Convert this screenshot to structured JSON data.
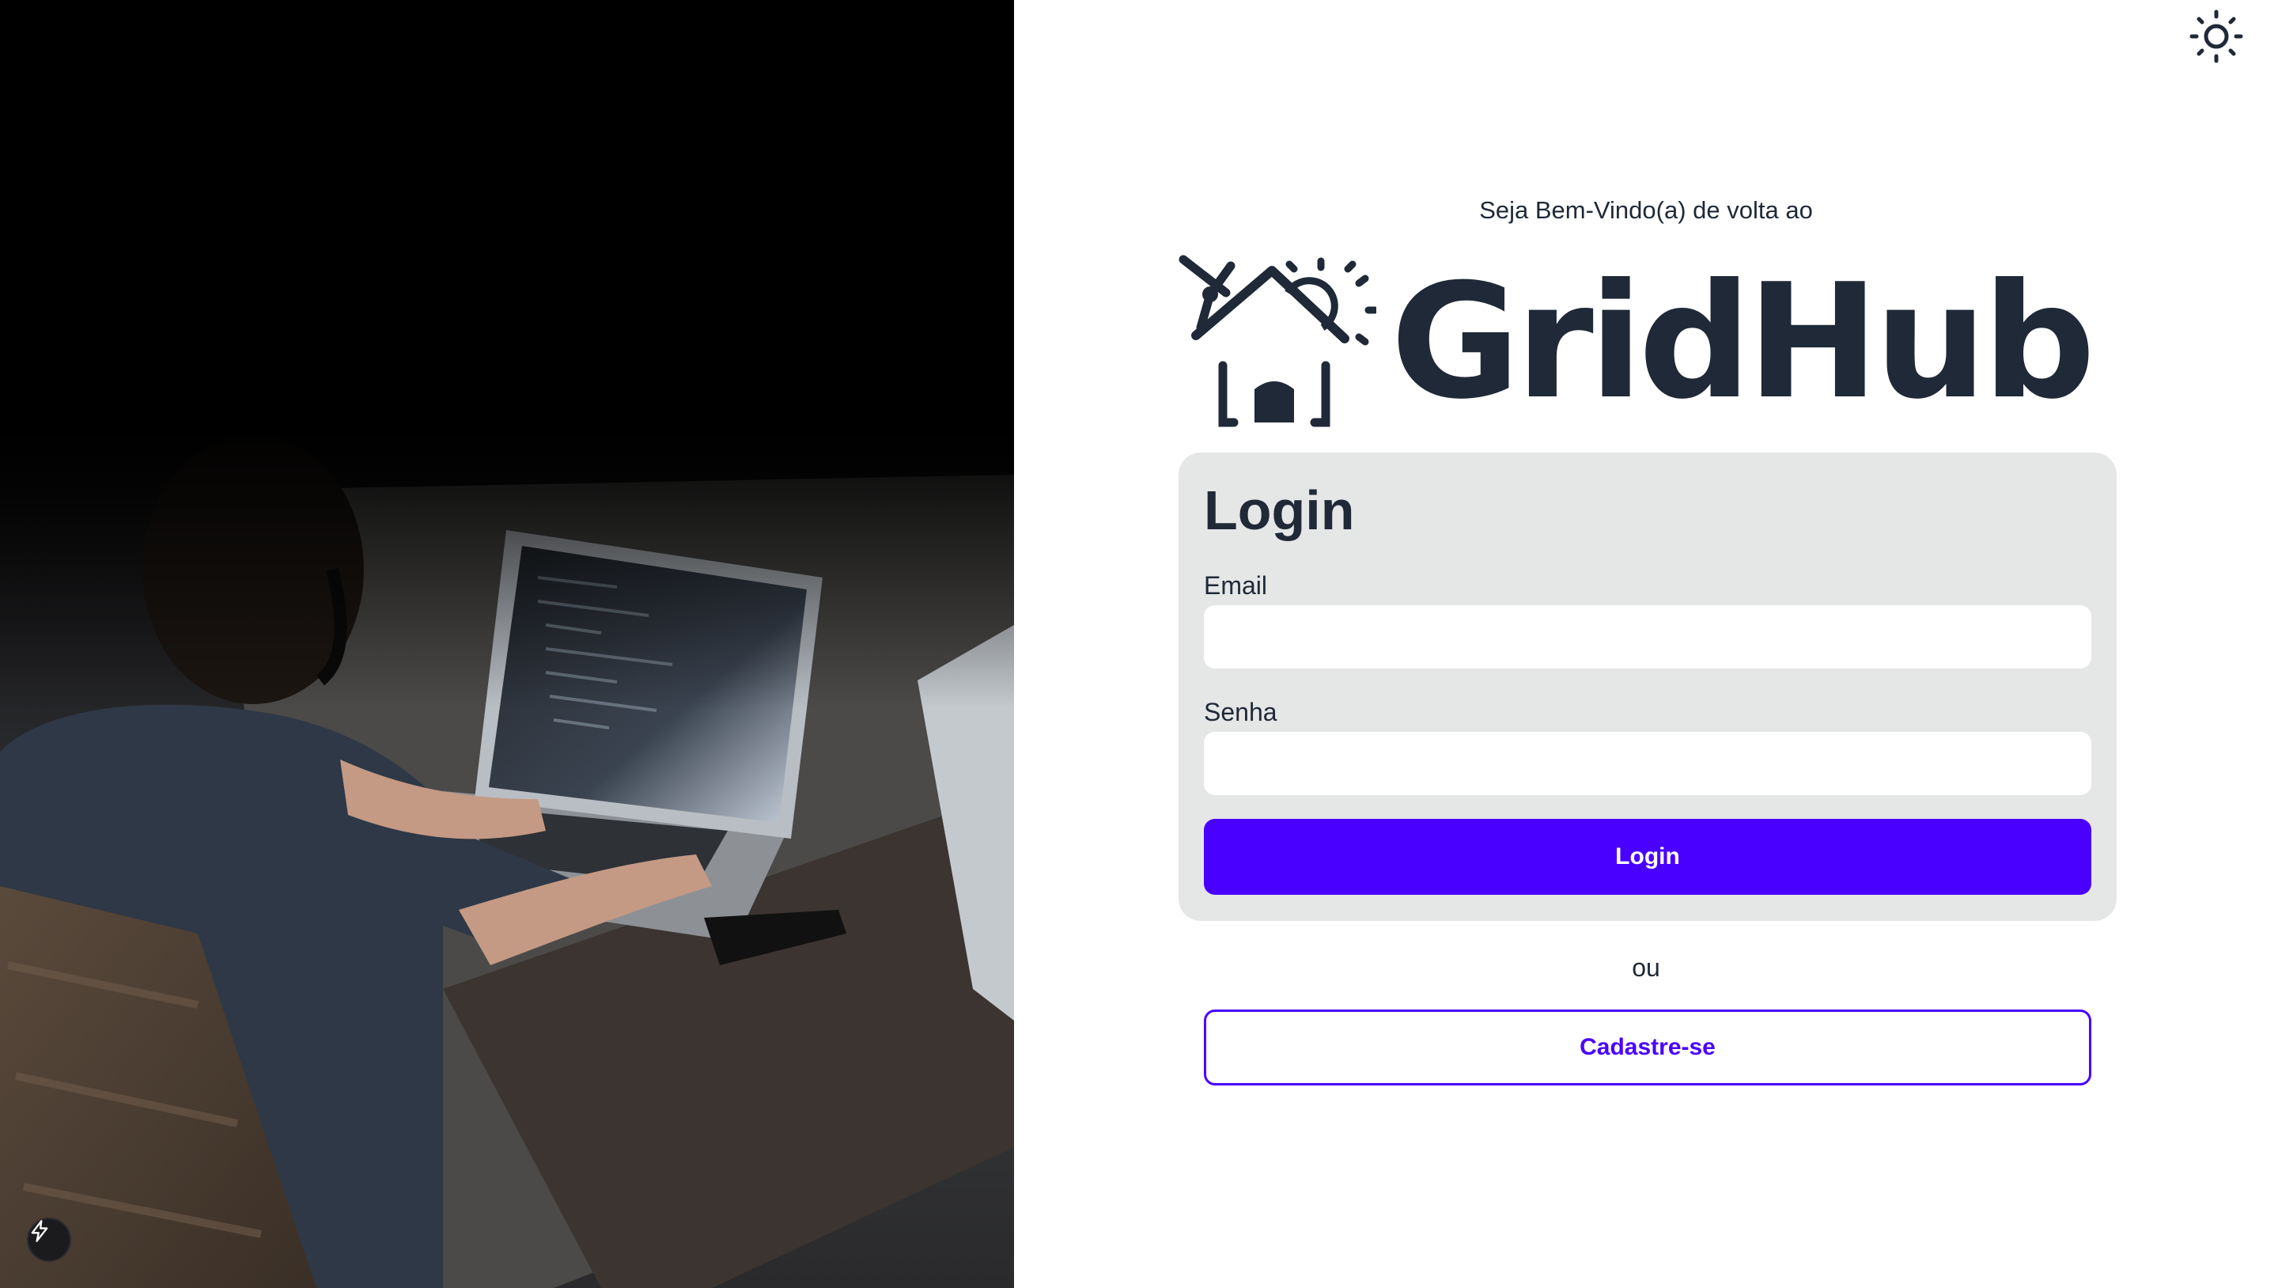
{
  "header": {
    "welcome": "Seja Bem-Vindo(a) de volta ao",
    "brand": "GridHub",
    "theme_icon": "sun-icon"
  },
  "login_card": {
    "title": "Login",
    "email_label": "Email",
    "email_value": "",
    "password_label": "Senha",
    "password_value": "",
    "submit_label": "Login"
  },
  "divider_text": "ou",
  "signup_label": "Cadastre-se",
  "hero": {
    "image": "person-coding-on-laptop-photo",
    "badge_icon": "lightning-icon"
  },
  "colors": {
    "accent": "#4a00ff",
    "card_bg": "#e5e6e6",
    "text": "#1f2937",
    "hero_bg": "#000000"
  }
}
